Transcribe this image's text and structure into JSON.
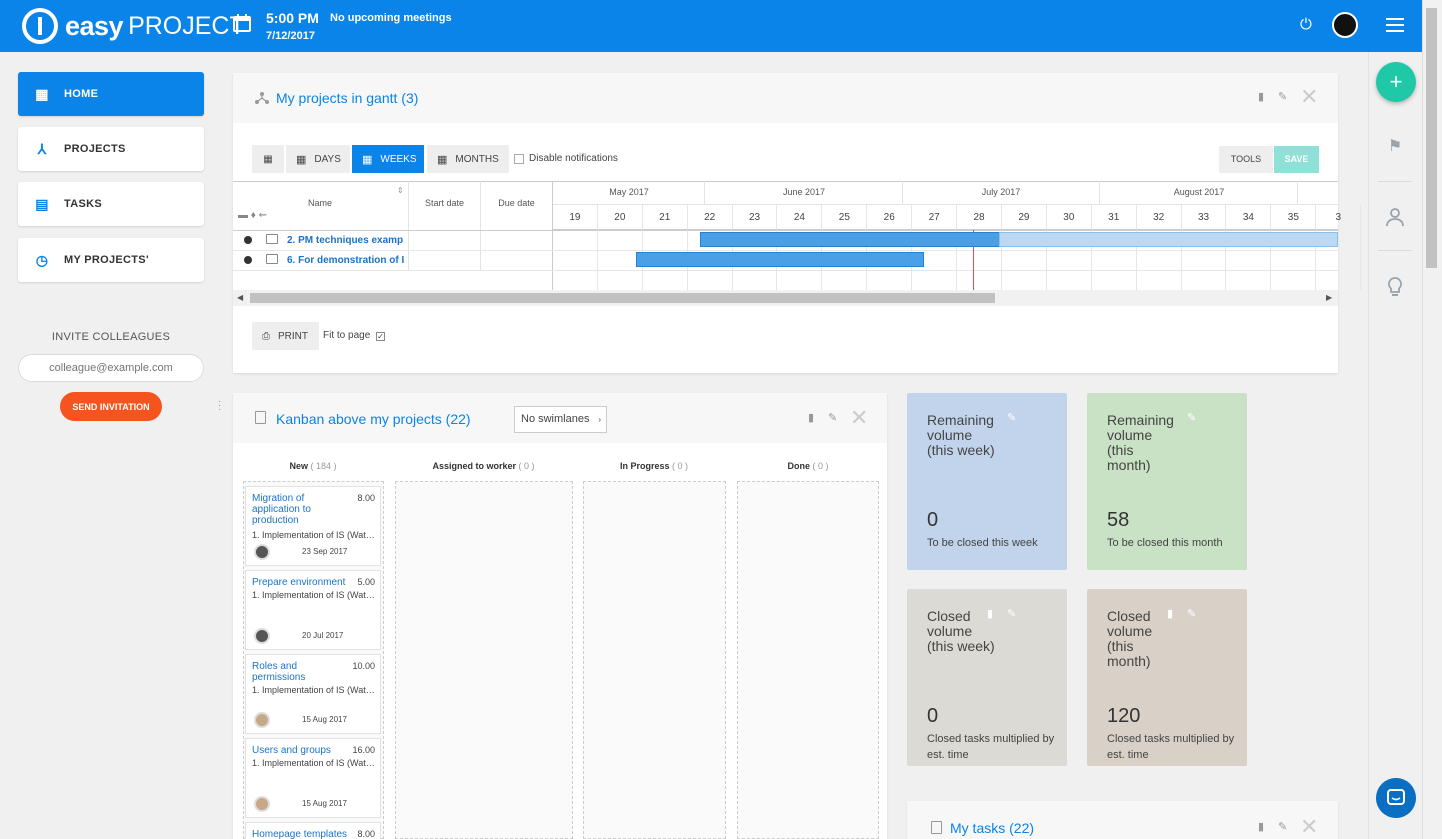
{
  "brand": {
    "part1": "easy",
    "part2": "PROJECT"
  },
  "header": {
    "time": "5:00 PM",
    "meetings": "No upcoming meetings",
    "date": "7/12/2017"
  },
  "nav": [
    {
      "label": "HOME",
      "active": true
    },
    {
      "label": "PROJECTS",
      "active": false
    },
    {
      "label": "TASKS",
      "active": false
    },
    {
      "label": "MY PROJECTS'",
      "active": false
    }
  ],
  "invite": {
    "title": "INVITE COLLEAGUES",
    "placeholder": "colleague@example.com",
    "button": "SEND INVITATION"
  },
  "gantt": {
    "title": "My projects in gantt (3)",
    "buttons": {
      "days": "DAYS",
      "weeks": "WEEKS",
      "months": "MONTHS",
      "tools": "TOOLS",
      "save": "SAVE"
    },
    "disable_notifications": "Disable notifications",
    "columns": {
      "name": "Name",
      "start": "Start date",
      "due": "Due date"
    },
    "months": [
      "May 2017",
      "June 2017",
      "July 2017",
      "August 2017"
    ],
    "weeks": [
      "19",
      "20",
      "21",
      "22",
      "23",
      "24",
      "25",
      "26",
      "27",
      "28",
      "29",
      "30",
      "31",
      "32",
      "33",
      "34",
      "35",
      "3"
    ],
    "rows": [
      {
        "name": "2. PM techniques examp"
      },
      {
        "name": "6. For demonstration of I"
      }
    ],
    "print": "PRINT",
    "fit_to_page": "Fit to page"
  },
  "kanban": {
    "title": "Kanban above my projects (22)",
    "swimlanes": "No swimlanes",
    "columns": [
      {
        "name": "New",
        "count": "( 184 )"
      },
      {
        "name": "Assigned to worker",
        "count": "( 0 )"
      },
      {
        "name": "In Progress",
        "count": "( 0 )"
      },
      {
        "name": "Done",
        "count": "( 0 )"
      }
    ],
    "cards": [
      {
        "title": "Migration of application to production",
        "estimate": "8.00",
        "project": "1. Implementation of IS (Wat…",
        "date": "23 Sep 2017"
      },
      {
        "title": "Prepare environment",
        "estimate": "5.00",
        "project": "1. Implementation of IS (Wat…",
        "date": "20 Jul 2017"
      },
      {
        "title": "Roles and permissions",
        "estimate": "10.00",
        "project": "1. Implementation of IS (Wat…",
        "date": "15 Aug 2017"
      },
      {
        "title": "Users and groups",
        "estimate": "16.00",
        "project": "1. Implementation of IS (Wat…",
        "date": "15 Aug 2017"
      },
      {
        "title": "Homepage templates",
        "estimate": "8.00"
      }
    ]
  },
  "tiles": [
    {
      "title": "Remaining volume (this week)",
      "value": "0",
      "subtitle": "To be closed this week",
      "color": "#c2d4ec"
    },
    {
      "title": "Remaining volume (this month)",
      "value": "58",
      "subtitle": "To be closed this month",
      "color": "#c9e2c5"
    },
    {
      "title": "Closed volume (this week)",
      "value": "0",
      "subtitle": "Closed tasks multiplied by est. time",
      "color": "#dcdad4"
    },
    {
      "title": "Closed volume (this month)",
      "value": "120",
      "subtitle": "Closed tasks multiplied by est. time",
      "color": "#d9d1c8"
    }
  ],
  "mytasks": {
    "title": "My tasks (22)"
  },
  "colors": {
    "primary": "#0a84e8",
    "accent": "#1fc9a8",
    "danger": "#f5541f"
  }
}
